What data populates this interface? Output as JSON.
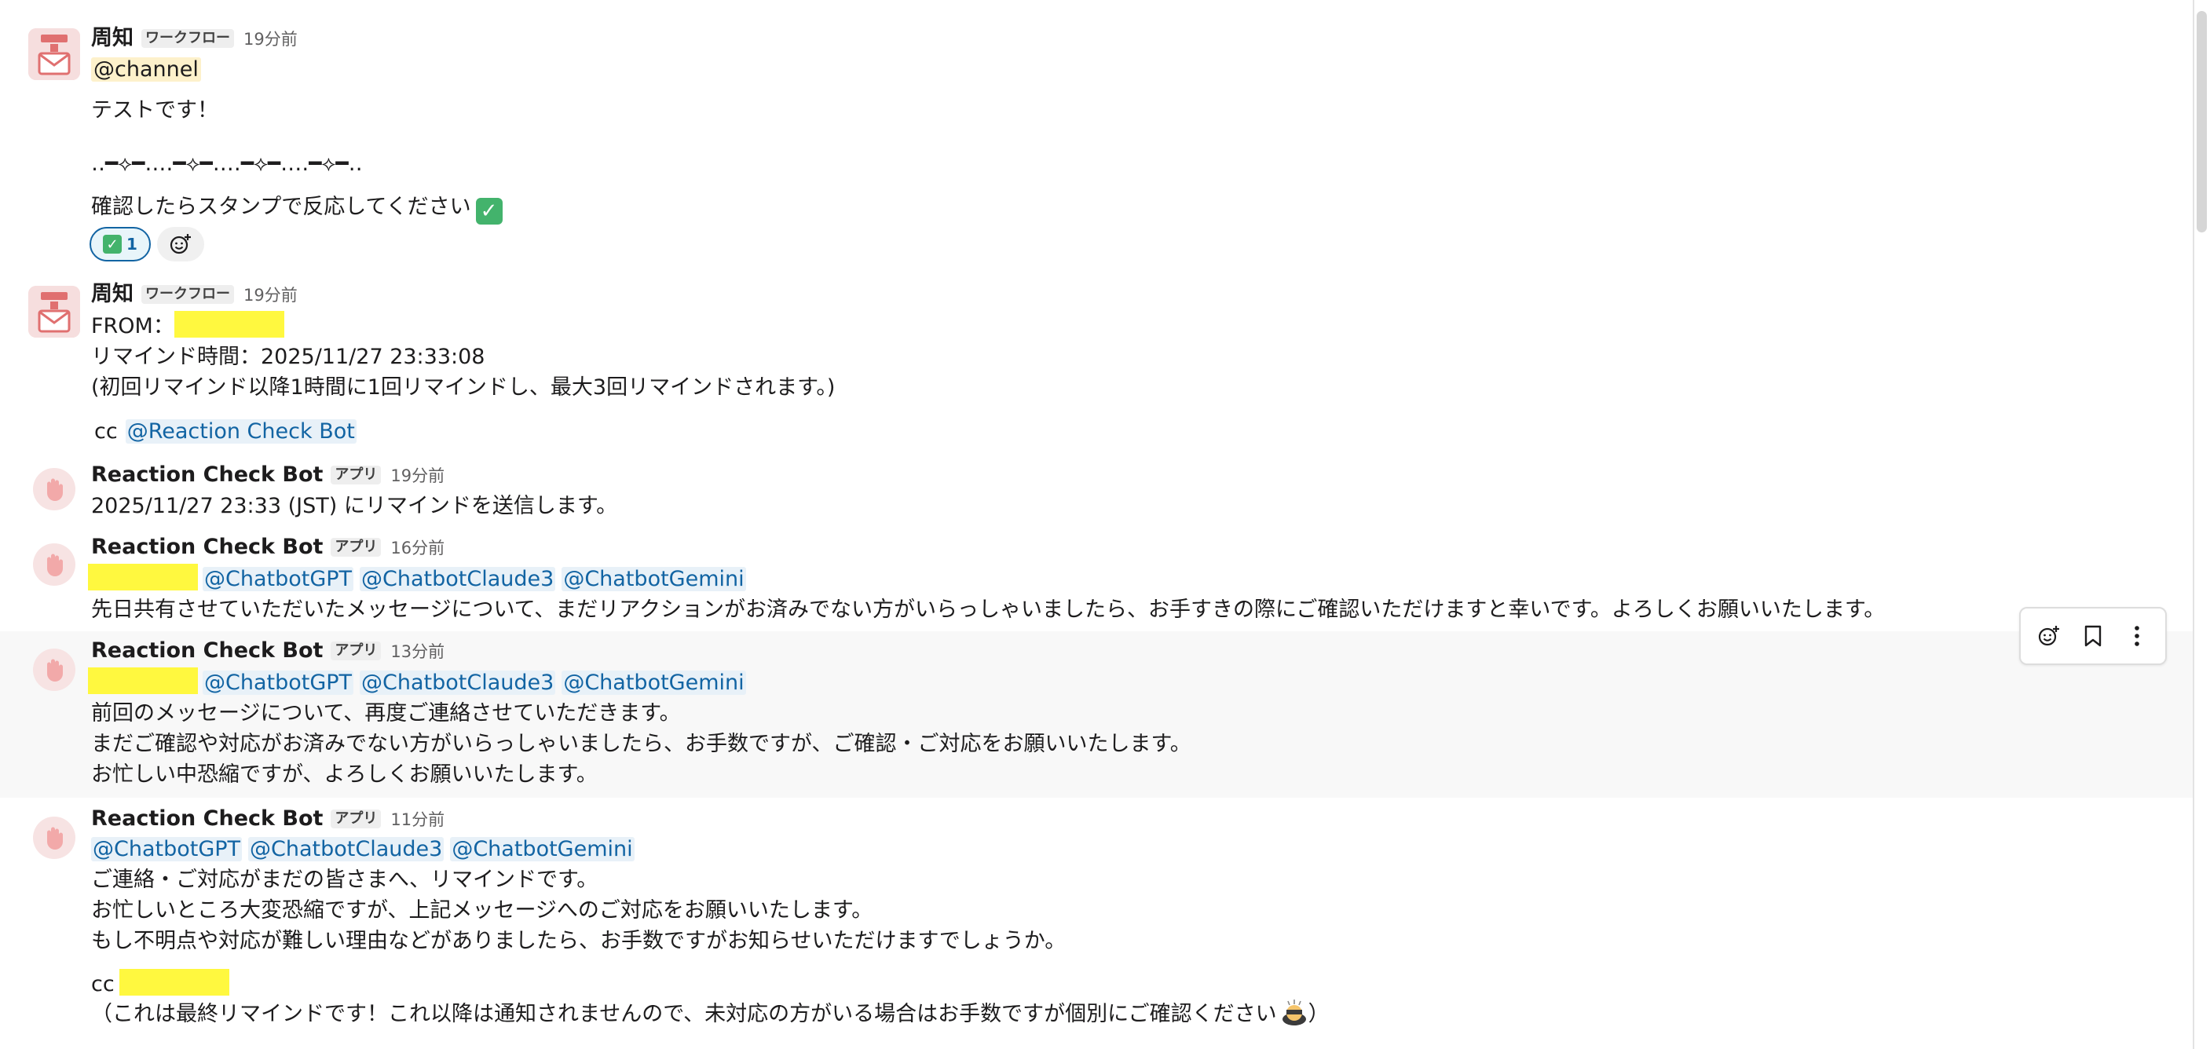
{
  "messages": [
    {
      "author": "周知",
      "tag": "ワークフロー",
      "time": "19分前",
      "channel_mention": "@channel",
      "lines": [
        "テストです！",
        "‥━⟡━‥‥━⟡━‥‥━⟡━‥‥━⟡━‥",
        "確認したらスタンプで反応してください"
      ],
      "reaction": {
        "count": "1"
      }
    },
    {
      "author": "周知",
      "tag": "ワークフロー",
      "time": "19分前",
      "from_label": "FROM：",
      "lines": [
        "リマインド時間：2025/11/27 23:33:08",
        "(初回リマインド以降1時間に1回リマインドし、最大3回リマインドされます。)"
      ],
      "cc_label": "cc",
      "cc_mention": "@Reaction Check Bot"
    },
    {
      "author": "Reaction Check Bot",
      "tag": "アプリ",
      "time": "19分前",
      "lines": [
        "2025/11/27 23:33 (JST) にリマインドを送信します。"
      ]
    },
    {
      "author": "Reaction Check Bot",
      "tag": "アプリ",
      "time": "16分前",
      "mentions": [
        "@ChatbotGPT",
        "@ChatbotClaude3",
        "@ChatbotGemini"
      ],
      "lines": [
        "先日共有させていただいたメッセージについて、まだリアクションがお済みでない方がいらっしゃいましたら、お手すきの際にご確認いただけますと幸いです。よろしくお願いいたします。"
      ]
    },
    {
      "author": "Reaction Check Bot",
      "tag": "アプリ",
      "time": "13分前",
      "mentions": [
        "@ChatbotGPT",
        "@ChatbotClaude3",
        "@ChatbotGemini"
      ],
      "lines": [
        "前回のメッセージについて、再度ご連絡させていただきます。",
        "まだご確認や対応がお済みでない方がいらっしゃいましたら、お手数ですが、ご確認・ご対応をお願いいたします。",
        "お忙しい中恐縮ですが、よろしくお願いいたします。"
      ]
    },
    {
      "author": "Reaction Check Bot",
      "tag": "アプリ",
      "time": "11分前",
      "mentions": [
        "@ChatbotGPT",
        "@ChatbotClaude3",
        "@ChatbotGemini"
      ],
      "lines": [
        "ご連絡・ご対応がまだの皆さまへ、リマインドです。",
        "お忙しいところ大変恐縮ですが、上記メッセージへのご対応をお願いいたします。",
        "もし不明点や対応が難しい理由などがありましたら、お手数ですがお知らせいただけますでしょうか。"
      ],
      "cc_label": "cc",
      "final_note": "（これは最終リマインドです！これ以降は通知されませんので、未対応の方がいる場合はお手数ですが個別にご確認ください",
      "final_note_close": "）"
    }
  ],
  "colors": {
    "mention_bg": "#e8f1f8",
    "mention_text": "#1264a3",
    "redaction": "#fff83f",
    "check_green": "#43b36c"
  },
  "icons": {
    "toolbar": [
      "add-reaction-icon",
      "bookmark-icon",
      "more-vertical-icon"
    ]
  }
}
